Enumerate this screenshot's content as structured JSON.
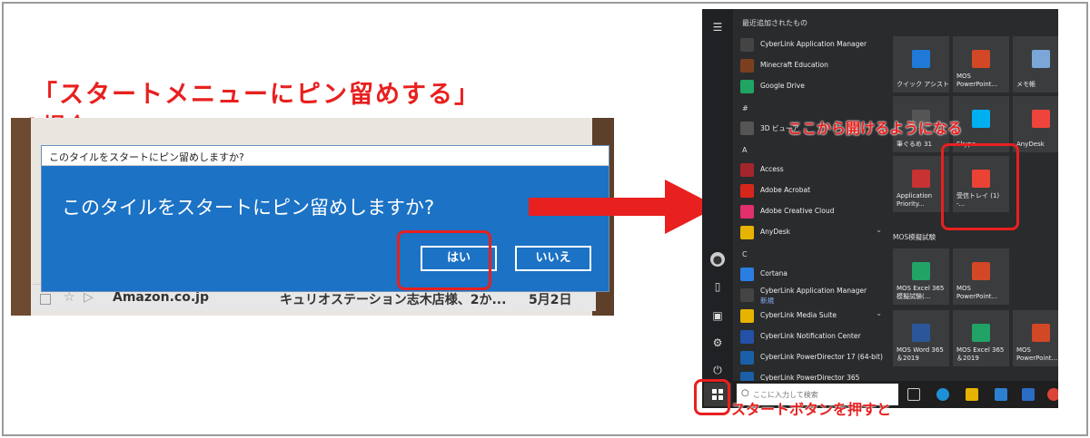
{
  "heading": {
    "line1": "「スタートメニューにピン留めする」",
    "line2": "の場合"
  },
  "dialog": {
    "titlebar": "このタイルをスタートにピン留めしますか?",
    "message": "このタイルをスタートにピン留めしますか?",
    "yes_label": "はい",
    "no_label": "いいえ"
  },
  "background_row": {
    "sender": "Amazon.co.jp",
    "subject": "キュリオステーション志木店様、2か...",
    "date": "5月2日"
  },
  "start_menu": {
    "recent_header": "最近追加されたもの",
    "apps": [
      {
        "label": "CyberLink Application Manager",
        "color": "#444444"
      },
      {
        "label": "Minecraft Education",
        "color": "#7b3f1f"
      },
      {
        "label": "Google Drive",
        "color": "#1fa463"
      },
      {
        "label": "#",
        "section": true
      },
      {
        "label": "3D ビューア",
        "color": "#555555"
      },
      {
        "label": "A",
        "section": true
      },
      {
        "label": "Access",
        "color": "#a4262c"
      },
      {
        "label": "Adobe Acrobat",
        "color": "#d6261b"
      },
      {
        "label": "Adobe Creative Cloud",
        "color": "#e1306c"
      },
      {
        "label": "AnyDesk",
        "color": "#e6b400",
        "chevron": true
      },
      {
        "label": "C",
        "section": true
      },
      {
        "label": "Cortana",
        "color": "#2a7de1"
      },
      {
        "label": "CyberLink Application Manager",
        "sub": "新規",
        "color": "#444444"
      },
      {
        "label": "CyberLink Media Suite",
        "color": "#e6b400",
        "chevron": true
      },
      {
        "label": "CyberLink Notification Center",
        "color": "#2450a8"
      },
      {
        "label": "CyberLink PowerDirector 17 (64-bit)",
        "color": "#1a5fa8"
      },
      {
        "label": "CyberLink PowerDirector 365",
        "color": "#1a5fa8"
      }
    ],
    "tiles": [
      {
        "label": "クイック アシスト",
        "color": "#1e7ad6"
      },
      {
        "label": "MOS\nPowerPoint...",
        "color": "#d24726"
      },
      {
        "label": "メモ帳",
        "color": "#7aa7d8"
      },
      {
        "label": "筆ぐるめ 31",
        "color": "#555555"
      },
      {
        "label": "Skype",
        "color": "#00aff0"
      },
      {
        "label": "AnyDesk",
        "color": "#ef443b"
      },
      {
        "label": "Application\nPriority...",
        "color": "#c83232"
      },
      {
        "label": "受信トレイ (1) -...",
        "color": "#ea4335"
      }
    ],
    "group_mos": "MOS模擬試験",
    "mos_tiles": [
      {
        "label": "MOS Excel 365\n模擬試験(...",
        "color": "#21a366"
      },
      {
        "label": "MOS\nPowerPoint...",
        "color": "#d24726"
      },
      {
        "label": "MOS Word 365\n＆2019",
        "color": "#2b579a"
      },
      {
        "label": "MOS Excel 365\n＆2019",
        "color": "#21a366"
      },
      {
        "label": "MOS\nPowerPoint...",
        "color": "#d24726"
      }
    ],
    "search_placeholder": "ここに入力して検索"
  },
  "annotations": {
    "open_from_here": "ここから開けるようになる",
    "press_start": "スタートボタンを押すと"
  },
  "colors": {
    "accent_red": "#e8201f",
    "dialog_blue": "#1c72c4",
    "menu_bg": "#2a2b2d"
  }
}
